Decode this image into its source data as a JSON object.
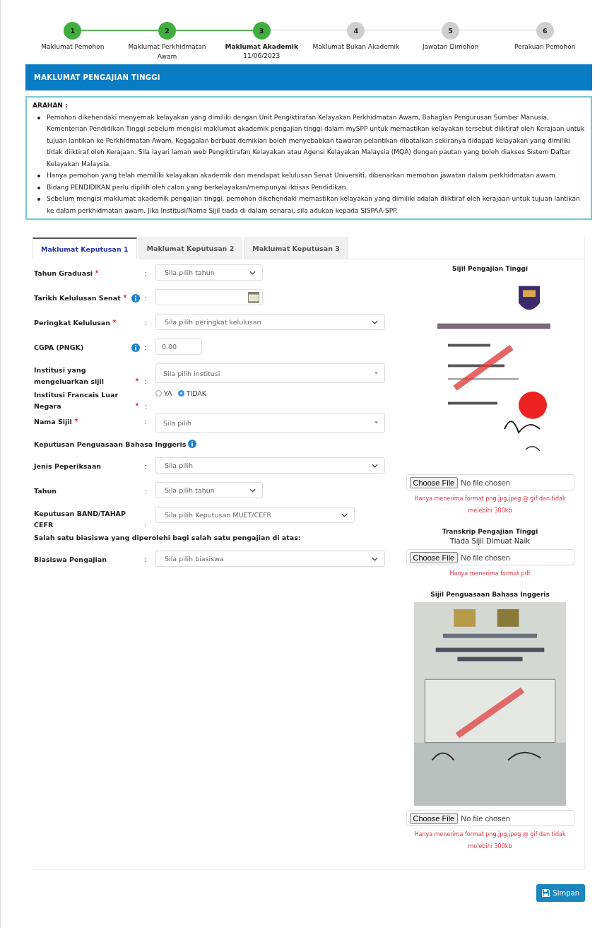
{
  "steps": [
    {
      "number": "1",
      "label": "Maklumat Pemohon",
      "completed": true,
      "selected": false
    },
    {
      "number": "2",
      "label": "Maklumat Perkhidmatan Awam",
      "completed": true,
      "selected": false
    },
    {
      "number": "3",
      "label": "Maklumat Akademik",
      "date": "11/06/2023",
      "completed": true,
      "selected": true
    },
    {
      "number": "4",
      "label": "Maklumat Bukan Akademik",
      "completed": false,
      "selected": false
    },
    {
      "number": "5",
      "label": "Jawatan Dimohon",
      "completed": false,
      "selected": false
    },
    {
      "number": "6",
      "label": "Perakuan Pemohon",
      "completed": false,
      "selected": false
    }
  ],
  "section_title": "MAKLUMAT PENGAJIAN TINGGI",
  "instructions": {
    "title": "ARAHAN :",
    "items": [
      "Pemohon dikehendaki menyemak kelayakan yang dimiliki dengan Unit Pengiktirafan Kelayakan Perkhidmatan Awam, Bahagian Pengurusan Sumber Manusia, Kementerian Pendidikan Tinggi sebelum mengisi maklumat akademik pengajian tinggi dalam mySPP untuk memastikan kelayakan tersebut diiktiraf oleh Kerajaan untuk tujuan lantikan ke Perkhidmatan Awam. Kegagalan berbuat demikian boleh menyebabkan tawaran pelantikan dibatalkan sekiranya didapati kelayakan yang dimiliki tidak diiktiraf oleh Kerajaan. Sila layari laman web Pengiktirafan Kelayakan atau Agensi Kelayakan Malaysia (MQA) dengan pautan yang boleh diakses Sistem Daftar Kelayakan Malaysia.",
      "Hanya pemohon yang telah memiliki kelayakan akademik dan mendapat kelulusan Senat Universiti, dibenarkan memohon jawatan dalam perkhidmatan awam.",
      "Bidang PENDIDIKAN perlu dipilih oleh calon yang berkelayakan/mempunyai iktisas Pendidikan.",
      "Sebelum mengisi maklumat akademik pengajian tinggi, pemohon dikehendaki memastikan kelayakan yang dimiliki adalah diiktiraf oleh kerajaan untuk tujuan lantikan ke dalam perkhidmatan awam. Jika Institusi/Nama Sijil tiada di dalam senarai, sila adukan kepada SISPAA-SPP."
    ]
  },
  "tabs": [
    {
      "label": "Maklumat Keputusan 1",
      "selected": true
    },
    {
      "label": "Maklumat Keputusan 2",
      "selected": false
    },
    {
      "label": "Maklumat Keputusan 3",
      "selected": false
    }
  ],
  "fields": [
    {
      "kind": "select",
      "label": "Tahun Graduasi",
      "required": true,
      "info": false,
      "separator": ":",
      "placeholder": "Sila pilih tahun"
    },
    {
      "kind": "date",
      "label": "Tarikh Kelulusan Senat",
      "required": true,
      "info": true,
      "separator": ":"
    },
    {
      "kind": "select",
      "label": "Peringkat Kelulusan",
      "required": true,
      "info": false,
      "separator": ":",
      "placeholder": "Sila pilih peringkat kelulusan"
    },
    {
      "kind": "text",
      "label": "CGPA (PNGK)",
      "required": false,
      "info": true,
      "separator": ":",
      "placeholder": "0.00"
    },
    {
      "kind": "combo",
      "label": "Institusi yang mengeluarkan sijil",
      "required": true,
      "info": false,
      "separator": ":",
      "placeholder": "Sila pilih institusi"
    },
    {
      "kind": "radio",
      "label": "Institusi Francais Luar Negara",
      "required": true,
      "info": false,
      "separator": ":",
      "options": [
        {
          "label": "YA",
          "selected": false
        },
        {
          "label": "TIDAK",
          "selected": true
        }
      ]
    },
    {
      "kind": "combo",
      "label": "Nama Sijil",
      "required": true,
      "info": false,
      "separator": ":",
      "placeholder": "Sila pilih"
    },
    {
      "kind": "heading",
      "label": "Keputusan Penguasaan Bahasa Inggeris",
      "info": true
    },
    {
      "kind": "select",
      "label": "Jenis Peperiksaan",
      "required": false,
      "info": false,
      "separator": ":",
      "placeholder": "Sila pilih"
    },
    {
      "kind": "select",
      "label": "Tahun",
      "required": false,
      "info": false,
      "separator": ":",
      "placeholder": "Sila pilih tahun"
    },
    {
      "kind": "select",
      "label": "Keputusan BAND/TAHAP CEFR",
      "required": false,
      "info": false,
      "separator": ":",
      "placeholder": "Sila pilih Keputusan MUET/CEFR"
    },
    {
      "kind": "heading",
      "label": "Salah satu biasiswa yang diperolehi bagi salah satu pengajian di atas:",
      "info": false
    },
    {
      "kind": "select",
      "label": "Biasiswa Pengajian",
      "required": false,
      "info": false,
      "separator": ":",
      "placeholder": "Sila pilih biasiswa"
    }
  ],
  "uploads": [
    {
      "title": "Sijil Pengajian Tinggi",
      "button": "Choose File",
      "status": "No file chosen",
      "note": "Hanya menerima format png,jpg,jpeg @ gif dan tidak melebihi 300kb"
    },
    {
      "title": "Transkrip Pengajian Tinggi",
      "message": "Tiada Sijil Dimuat Naik",
      "button": "Choose File",
      "status": "No file chosen",
      "note": "Hanya menerima format pdf"
    },
    {
      "title": "Sijil Penguasaan Bahasa Inggeris",
      "button": "Choose File",
      "status": "No file chosen",
      "note": "Hanya menerima format png,jpg,jpeg @ gif dan tidak melebihi 300kb"
    }
  ],
  "save_button": "Simpan"
}
